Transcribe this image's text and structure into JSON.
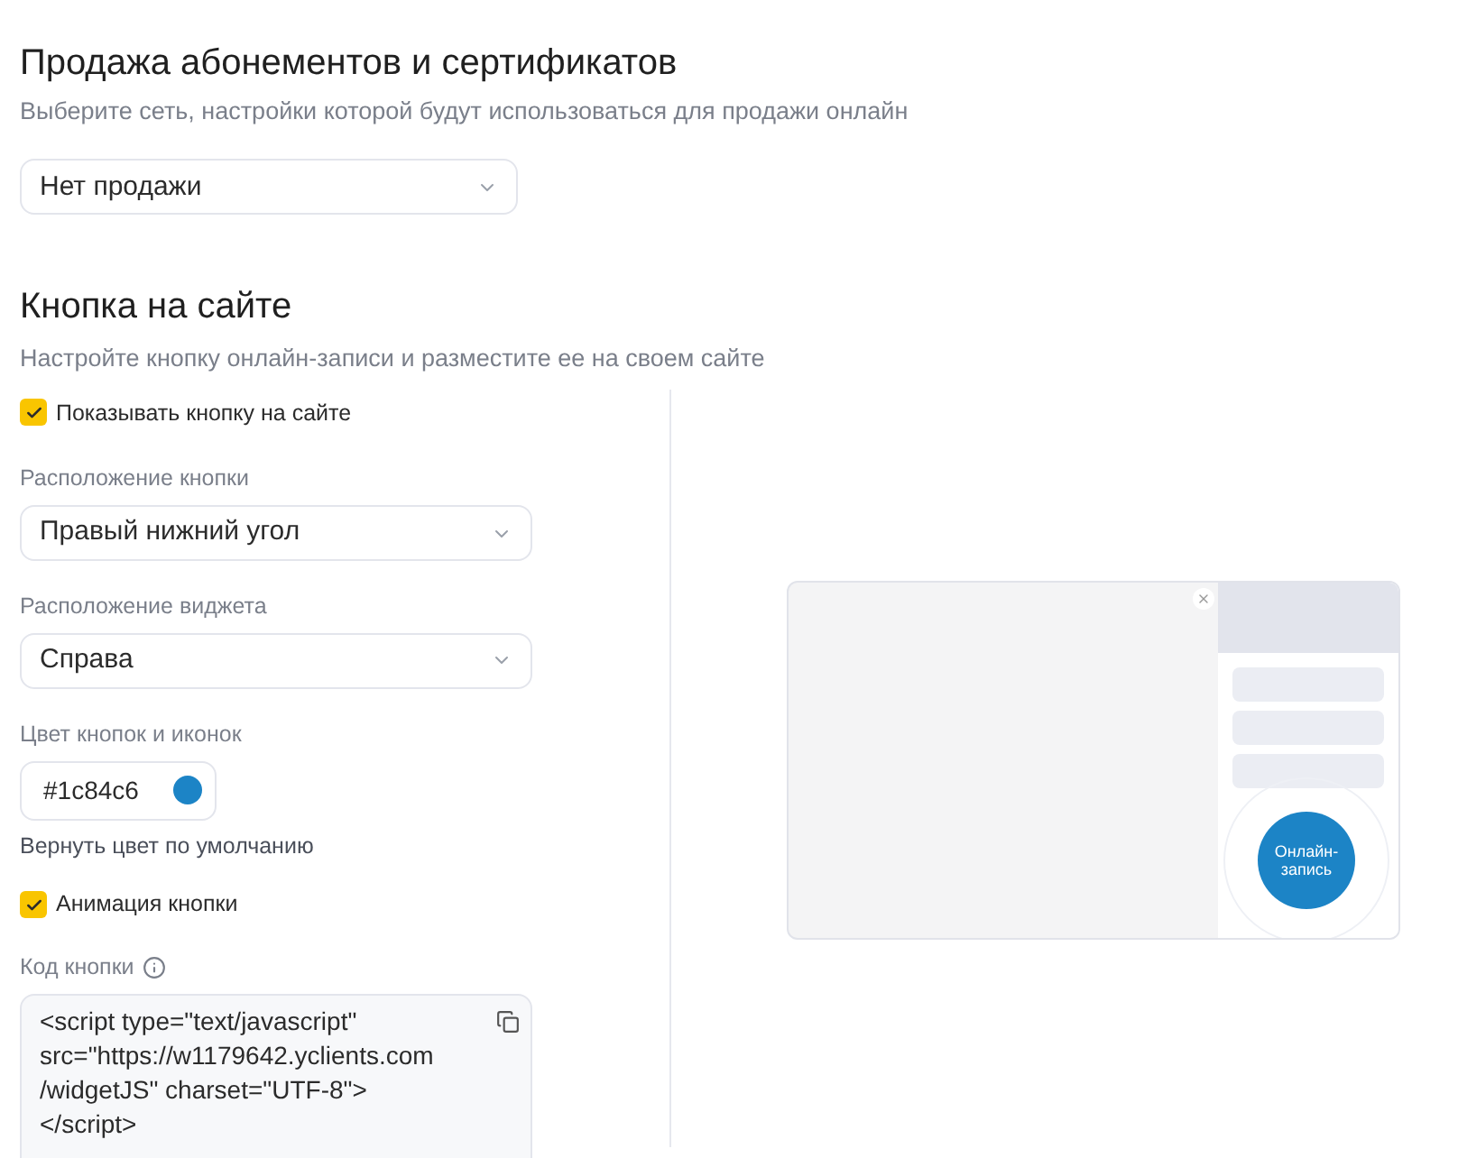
{
  "sale": {
    "title": "Продажа абонементов и сертификатов",
    "subtitle": "Выберите сеть, настройки которой будут использоваться для продажи онлайн",
    "select": {
      "value": "Нет продажи"
    }
  },
  "site_button": {
    "title": "Кнопка на сайте",
    "subtitle": "Настройте кнопку онлайн-записи и разместите ее на своем сайте",
    "show_checkbox": {
      "label": "Показывать кнопку на сайте",
      "checked": true
    },
    "position": {
      "label": "Расположение кнопки",
      "value": "Правый нижний угол"
    },
    "widget_position": {
      "label": "Расположение виджета",
      "value": "Справа"
    },
    "color": {
      "label": "Цвет кнопок и иконок",
      "value": "#1c84c6",
      "color": "#1c84c6"
    },
    "reset_link": "Вернуть цвет по умолчанию",
    "animation_checkbox": {
      "label": "Анимация кнопки",
      "checked": true
    },
    "code": {
      "label": "Код кнопки",
      "lines": [
        "<script type=\"text/javascript\"",
        "src=\"https://w1179642.yclients.com",
        "/widgetJS\" charset=\"UTF-8\">",
        "</script>"
      ]
    },
    "preview": {
      "button_label": "Онлайн-запись"
    }
  }
}
